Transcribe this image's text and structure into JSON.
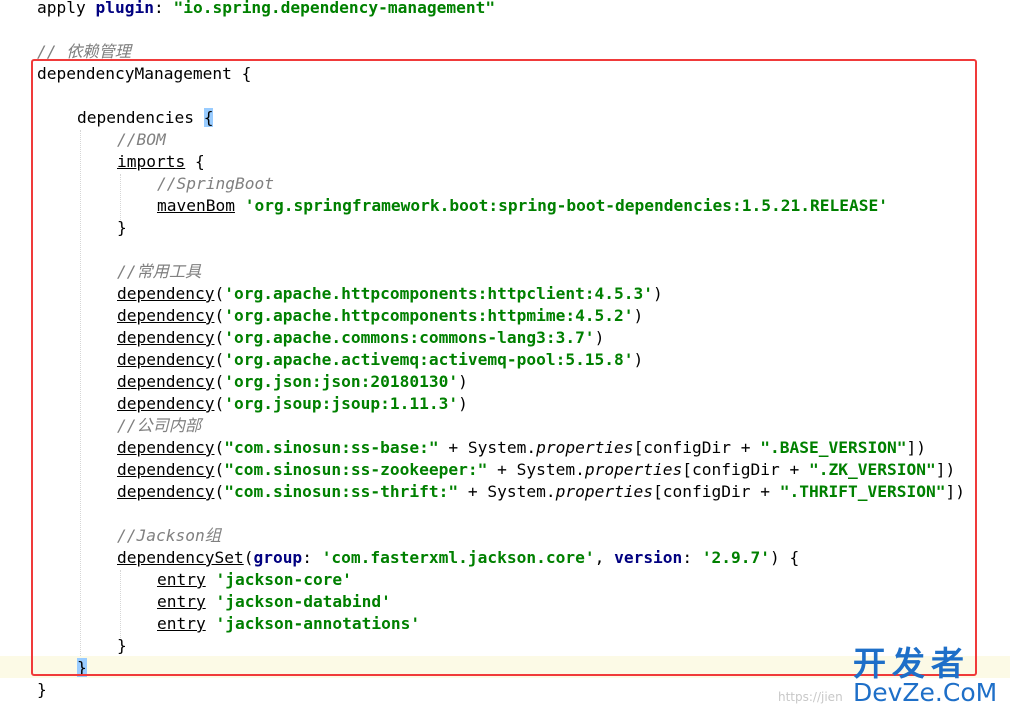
{
  "code": {
    "apply": {
      "kw": "apply",
      "plugin": "plugin",
      "colon": ": ",
      "value": "\"io.spring.dependency-management\""
    },
    "comment_dep_mgmt": "// 依赖管理",
    "dependencyManagement": "dependencyManagement {",
    "dependencies_kw": "dependencies ",
    "open_brace": "{",
    "comment_bom": "//BOM",
    "imports_kw": "imports",
    "imports_brace": " {",
    "comment_springboot": "//SpringBoot",
    "mavenBom_kw": "mavenBom",
    "mavenBom_value": "'org.springframework.boot:spring-boot-dependencies:1.5.21.RELEASE'",
    "close_imports": "}",
    "comment_tools": "//常用工具",
    "dependency_kw": "dependency",
    "deps_common": [
      "'org.apache.httpcomponents:httpclient:4.5.3'",
      "'org.apache.httpcomponents:httpmime:4.5.2'",
      "'org.apache.commons:commons-lang3:3.7'",
      "'org.apache.activemq:activemq-pool:5.15.8'",
      "'org.json:json:20180130'",
      "'org.jsoup:jsoup:1.11.3'"
    ],
    "comment_internal": "//公司内部",
    "deps_internal": [
      {
        "artifact": "\"com.sinosun:ss-base:\"",
        "key": "\".BASE_VERSION\""
      },
      {
        "artifact": "\"com.sinosun:ss-zookeeper:\"",
        "key": "\".ZK_VERSION\""
      },
      {
        "artifact": "\"com.sinosun:ss-thrift:\"",
        "key": "\".THRIFT_VERSION\""
      }
    ],
    "sys_prefix": " + System.",
    "properties": "properties",
    "config_expr": "[configDir + ",
    "comment_jackson": "//Jackson组",
    "dependencySet_kw": "dependencySet",
    "group_label": "group",
    "group_value": "'com.fasterxml.jackson.core'",
    "version_label": "version",
    "version_value": "'2.9.7'",
    "entry_kw": "entry",
    "entries": [
      "'jackson-core'",
      "'jackson-databind'",
      "'jackson-annotations'"
    ],
    "close_set": "}",
    "close_deps": "}",
    "close_mgmt": "}"
  },
  "watermark": {
    "title": "开发者",
    "subtitle": "DevZe.CoM",
    "url": "https://jien"
  },
  "colors": {
    "string": "#008000",
    "keyword": "#000080",
    "comment": "#808080",
    "highlight_box": "#f03a3a",
    "brace_match": "#99ccff",
    "watermark": "#1e6fc8"
  }
}
